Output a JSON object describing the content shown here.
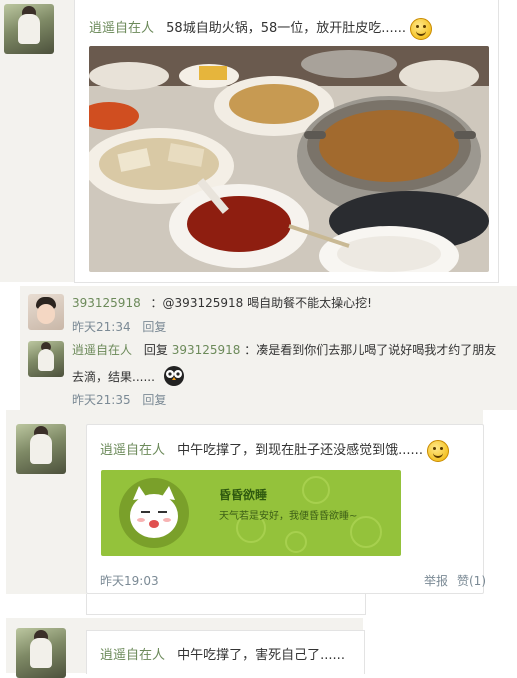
{
  "post1": {
    "author": "逍遥自在人",
    "text": "58城自助火锅，58一位，放开肚皮吃......"
  },
  "thread": {
    "reply1": {
      "user": "393125918",
      "text": "：@393125918 喝自助餐不能太操心挖!",
      "time": "昨天21:34",
      "reply_label": "回复"
    },
    "reply2": {
      "user": "逍遥自在人",
      "prefix": "回复",
      "target": "393125918",
      "text_line1": "：凑是看到你们去那儿喝了说好喝我才约了朋友",
      "text_line2": "去滴，结果......",
      "time": "昨天21:35",
      "reply_label": "回复"
    }
  },
  "post2": {
    "author": "逍遥自在人",
    "text": "中午吃撑了，到现在肚子还没感觉到饿......",
    "card": {
      "title": "昏昏欲睡",
      "subtitle": "天气若是安好，我便昏昏欲睡~"
    },
    "time": "昨天19:03",
    "report_label": "举报",
    "like_label": "赞(1)"
  },
  "post3": {
    "author": "逍遥自在人",
    "text": "中午吃撑了，害死自己了......"
  },
  "colors": {
    "accent_green": "#94c23b",
    "name_green": "#6c8a5a",
    "meta_gray": "#7b8a95"
  }
}
